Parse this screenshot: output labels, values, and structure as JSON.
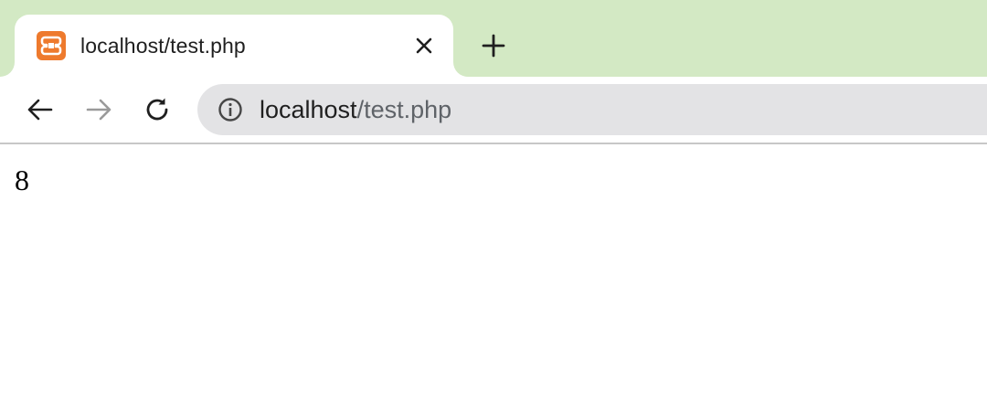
{
  "browser": {
    "tab": {
      "title": "localhost/test.php",
      "favicon": "xampp-icon"
    },
    "new_tab_icon": "plus-icon",
    "close_tab_icon": "close-icon",
    "nav": {
      "back_icon": "arrow-left-icon",
      "forward_icon": "arrow-right-icon",
      "reload_icon": "reload-icon"
    },
    "address_bar": {
      "security_icon": "info-icon",
      "url_host": "localhost",
      "url_path": "/test.php"
    },
    "colors": {
      "tabstrip_bg": "#d3e9c4",
      "omnibox_bg": "#e3e3e5",
      "favicon_orange": "#ee7a2d"
    }
  },
  "page": {
    "body_text": "8"
  }
}
